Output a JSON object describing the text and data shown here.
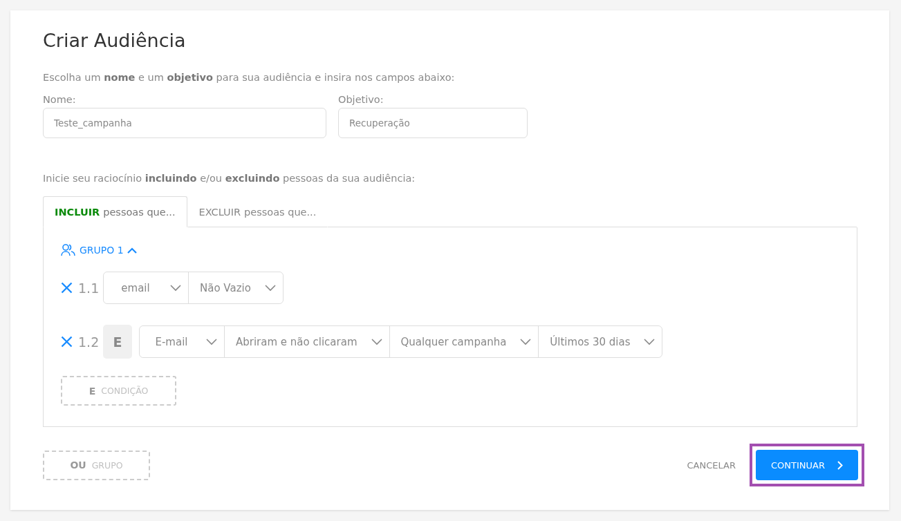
{
  "title": "Criar Audiência",
  "intro": "Escolha um **nome** e um **objetivo** para sua audiência e insira nos campos abaixo:",
  "fields": [
    {
      "label": "Nome:",
      "value": "Teste_campanha"
    },
    {
      "label": "Objetivo:",
      "value": "Recuperação"
    }
  ],
  "reasoning_hint": "Inicie seu raciocínio **incluindo** e/ou **excluindo** pessoas da sua audiência:",
  "tabs": [
    {
      "keyword": "INCLUIR",
      "label": "pessoas que...",
      "selected": true
    },
    {
      "keyword": "EXCLUIR",
      "label": "pessoas que...",
      "selected": false
    }
  ],
  "group": {
    "label": "GRUPO 1",
    "expanded": true,
    "conditions": [
      {
        "number": "1.1",
        "dropdowns": [
          "email",
          "Não Vazio"
        ]
      },
      {
        "number": "1.2",
        "connector": "E",
        "dropdowns": [
          "E-mail",
          "Abriram e não clicaram",
          "Qualquer campanha",
          "Últimos 30 dias"
        ]
      }
    ],
    "add_condition": {
      "keyword": "E",
      "label": "CONDIÇÃO"
    }
  },
  "add_group": {
    "keyword": "OU",
    "label": "GRUPO"
  },
  "cancel": "CANCELAR",
  "continue": {
    "label": "CONTINUAR",
    "highlighted": true
  }
}
